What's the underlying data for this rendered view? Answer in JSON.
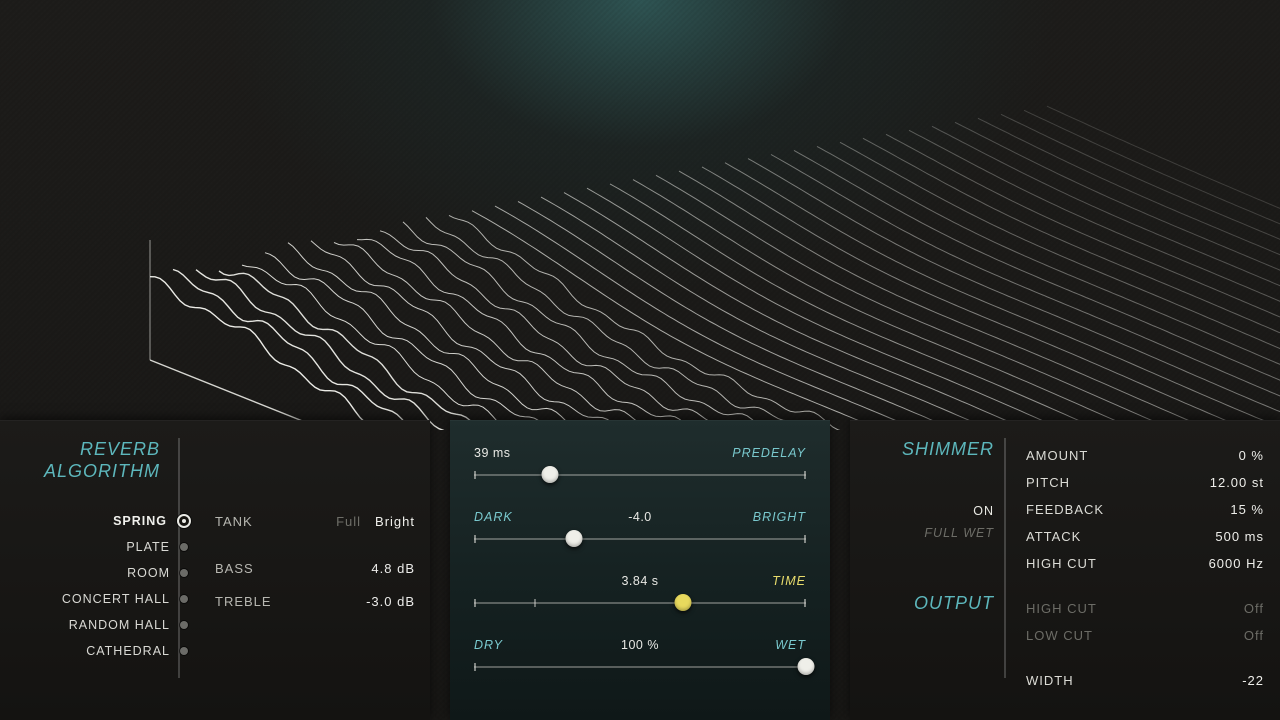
{
  "sections": {
    "algorithm_title1": "REVERB",
    "algorithm_title2": "ALGORITHM",
    "shimmer_title": "SHIMMER",
    "output_title": "OUTPUT"
  },
  "algorithms": [
    {
      "label": "SPRING",
      "selected": true
    },
    {
      "label": "PLATE",
      "selected": false
    },
    {
      "label": "ROOM",
      "selected": false
    },
    {
      "label": "CONCERT HALL",
      "selected": false
    },
    {
      "label": "RANDOM HALL",
      "selected": false
    },
    {
      "label": "CATHEDRAL",
      "selected": false
    }
  ],
  "tone": {
    "tank_label": "TANK",
    "tank_options": [
      {
        "label": "Full",
        "active": false
      },
      {
        "label": "Bright",
        "active": true
      }
    ],
    "bass": {
      "label": "BASS",
      "value": "4.8 dB"
    },
    "treble": {
      "label": "TREBLE",
      "value": "-3.0 dB"
    }
  },
  "sliders": {
    "predelay": {
      "left": "",
      "right": "PREDELAY",
      "value": "39 ms",
      "pos": 0.23,
      "accent": false
    },
    "color": {
      "left": "DARK",
      "right": "BRIGHT",
      "value": "-4.0",
      "pos": 0.3,
      "accent": false
    },
    "time": {
      "left": "",
      "right": "TIME",
      "value": "3.84 s",
      "pos": 0.63,
      "accent": true,
      "tick": 0.18
    },
    "mix": {
      "left": "DRY",
      "right": "WET",
      "value": "100 %",
      "pos": 1.0,
      "accent": false
    }
  },
  "shimmer_toggle": {
    "on": "ON",
    "off": "FULL WET",
    "state": "on"
  },
  "shimmer": [
    {
      "name": "AMOUNT",
      "value": "0 %"
    },
    {
      "name": "PITCH",
      "value": "12.00 st"
    },
    {
      "name": "FEEDBACK",
      "value": "15 %"
    },
    {
      "name": "ATTACK",
      "value": "500 ms"
    },
    {
      "name": "HIGH CUT",
      "value": "6000 Hz"
    }
  ],
  "output": [
    {
      "name": "HIGH CUT",
      "value": "Off",
      "dim": true
    },
    {
      "name": "LOW CUT",
      "value": "Off",
      "dim": true
    },
    {
      "name": "WIDTH",
      "value": "-22"
    }
  ],
  "colors": {
    "accent_teal": "#5db7bc",
    "accent_yellow": "#e8dc6c"
  }
}
